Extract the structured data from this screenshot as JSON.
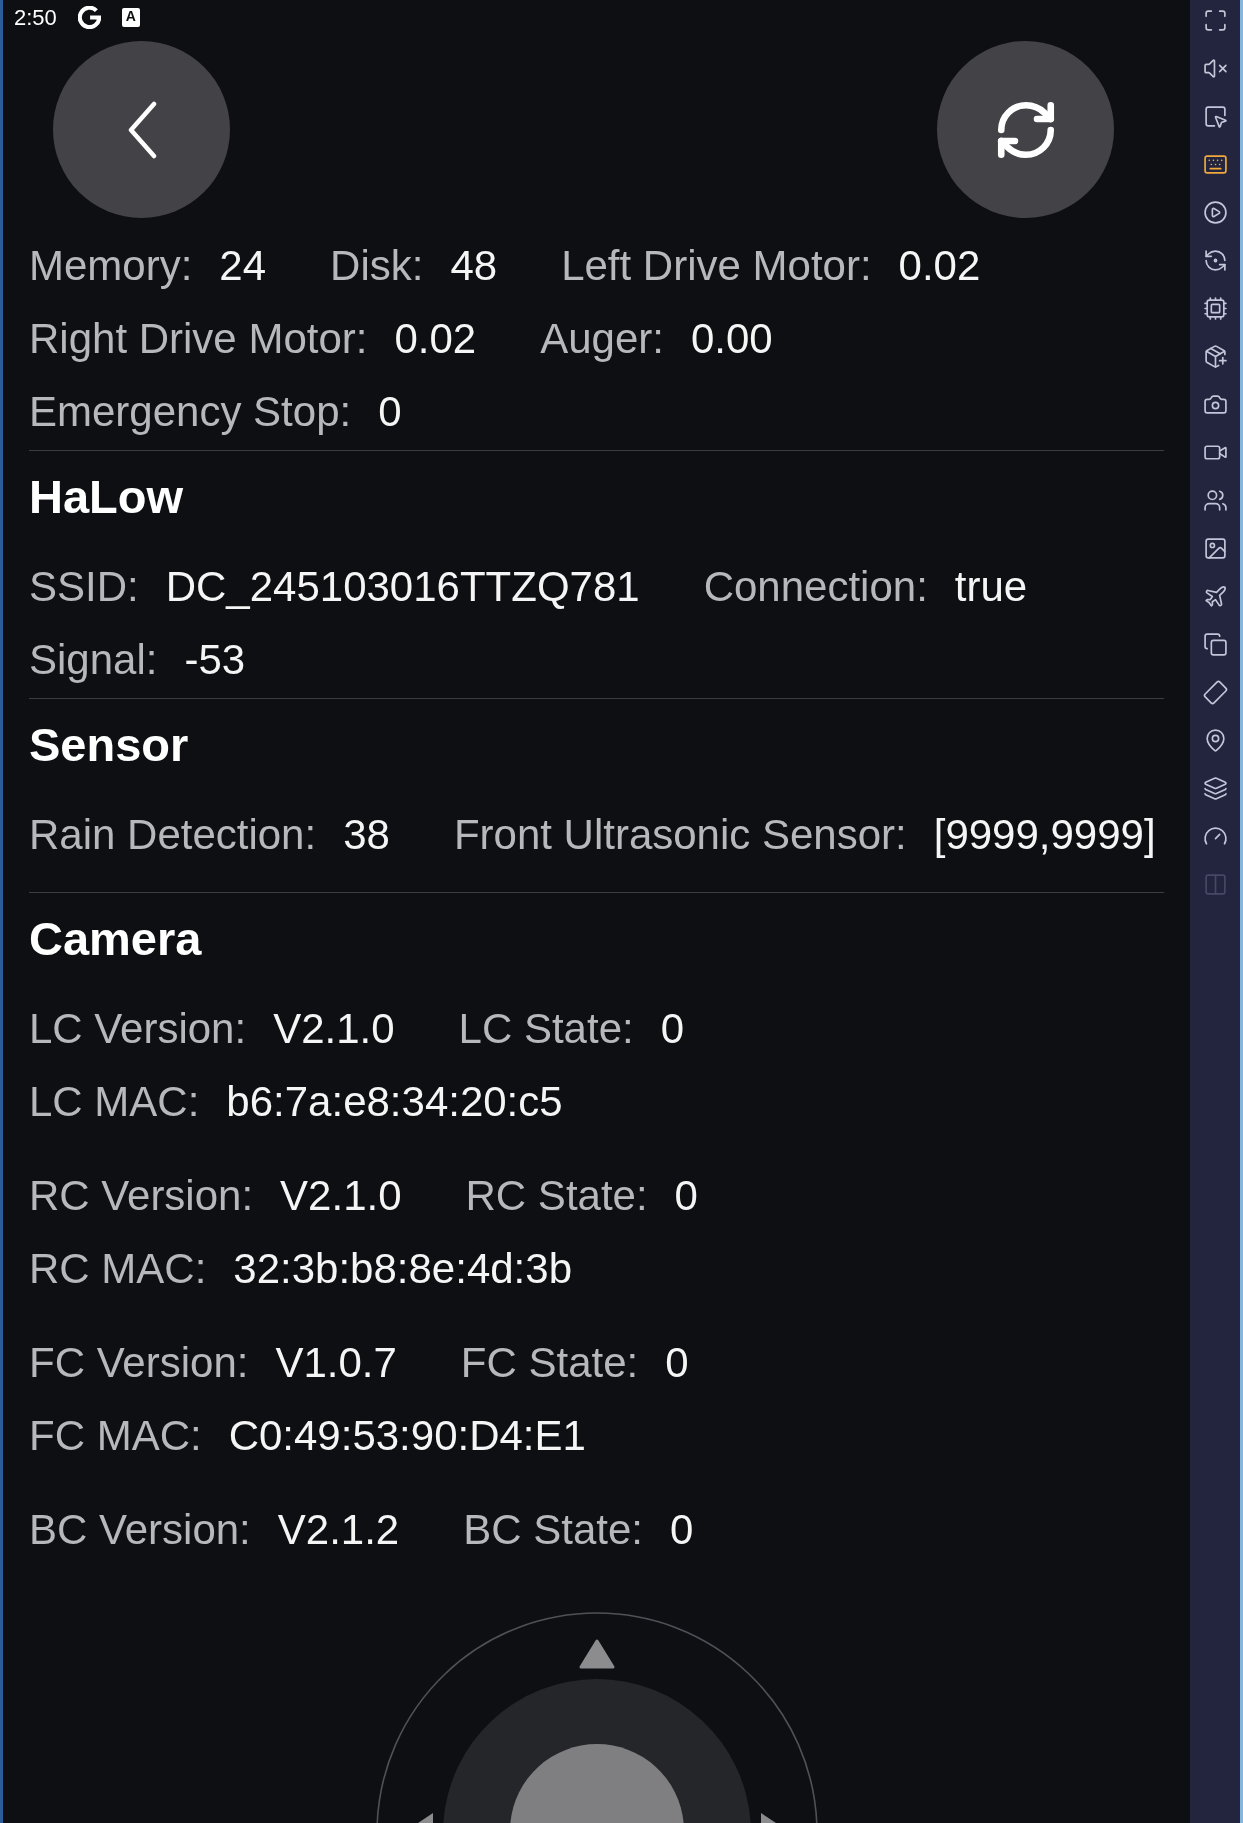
{
  "status_bar": {
    "time": "2:50",
    "badge": "A"
  },
  "sections": [
    {
      "groups": [
        {
          "rows": [
            {
              "items": [
                {
                  "label": "Memory:",
                  "value": "24"
                },
                {
                  "label": "Disk:",
                  "value": "48"
                },
                {
                  "label": "Left Drive Motor:",
                  "value": "0.02"
                }
              ]
            },
            {
              "items": [
                {
                  "label": "Right Drive Motor:",
                  "value": "0.02"
                },
                {
                  "label": "Auger:",
                  "value": "0.00"
                }
              ]
            },
            {
              "items": [
                {
                  "label": "Emergency Stop:",
                  "value": "0"
                }
              ]
            }
          ]
        }
      ]
    },
    {
      "title": "HaLow",
      "groups": [
        {
          "rows": [
            {
              "items": [
                {
                  "label": "SSID:",
                  "value": "DC_245103016TTZQ781"
                },
                {
                  "label": "Connection:",
                  "value": "true"
                }
              ]
            },
            {
              "items": [
                {
                  "label": "Signal:",
                  "value": "-53"
                }
              ]
            }
          ]
        }
      ]
    },
    {
      "title": "Sensor",
      "groups": [
        {
          "rows": [
            {
              "items": [
                {
                  "label": "Rain Detection:",
                  "value": "38"
                },
                {
                  "label": "Front Ultrasonic Sensor:",
                  "value": "[9999,9999]"
                }
              ]
            }
          ]
        }
      ]
    },
    {
      "title": "Camera",
      "groups": [
        {
          "rows": [
            {
              "items": [
                {
                  "label": "LC Version:",
                  "value": "V2.1.0"
                },
                {
                  "label": "LC State:",
                  "value": "0"
                }
              ]
            },
            {
              "items": [
                {
                  "label": "LC MAC:",
                  "value": "b6:7a:e8:34:20:c5"
                }
              ]
            }
          ]
        },
        {
          "rows": [
            {
              "items": [
                {
                  "label": "RC Version:",
                  "value": "V2.1.0"
                },
                {
                  "label": "RC State:",
                  "value": "0"
                }
              ]
            },
            {
              "items": [
                {
                  "label": "RC MAC:",
                  "value": "32:3b:b8:8e:4d:3b"
                }
              ]
            }
          ]
        },
        {
          "rows": [
            {
              "items": [
                {
                  "label": "FC Version:",
                  "value": "V1.0.7"
                },
                {
                  "label": "FC State:",
                  "value": "0"
                }
              ]
            },
            {
              "items": [
                {
                  "label": "FC MAC:",
                  "value": "C0:49:53:90:D4:E1"
                }
              ]
            }
          ]
        },
        {
          "rows": [
            {
              "items": [
                {
                  "label": "BC Version:",
                  "value": "V2.1.2"
                },
                {
                  "label": "BC State:",
                  "value": "0"
                }
              ]
            }
          ]
        }
      ]
    }
  ],
  "sidebar": {
    "tools": [
      {
        "selected": false,
        "disabled": false
      },
      {
        "selected": false,
        "disabled": false
      },
      {
        "selected": false,
        "disabled": false
      },
      {
        "selected": true,
        "disabled": false
      },
      {
        "selected": false,
        "disabled": false
      },
      {
        "selected": false,
        "disabled": false
      },
      {
        "selected": false,
        "disabled": false
      },
      {
        "selected": false,
        "disabled": false
      },
      {
        "selected": false,
        "disabled": false
      },
      {
        "selected": false,
        "disabled": false
      },
      {
        "selected": false,
        "disabled": false
      },
      {
        "selected": false,
        "disabled": false
      },
      {
        "selected": false,
        "disabled": false
      },
      {
        "selected": false,
        "disabled": false
      },
      {
        "selected": false,
        "disabled": false
      },
      {
        "selected": false,
        "disabled": false
      },
      {
        "selected": false,
        "disabled": false
      },
      {
        "selected": false,
        "disabled": false
      },
      {
        "selected": false,
        "disabled": true
      }
    ]
  }
}
